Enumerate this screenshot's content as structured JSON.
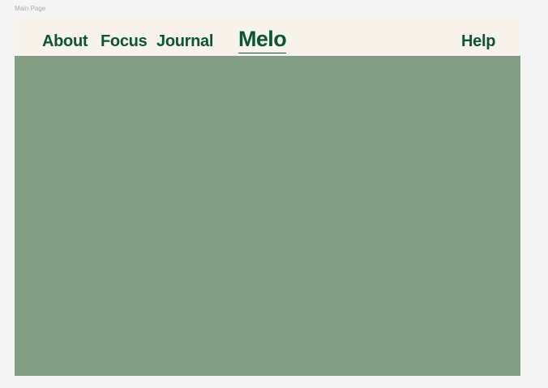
{
  "canvas": {
    "frame_label": "Main Page"
  },
  "nav": {
    "about": "About",
    "focus": "Focus",
    "journal": "Journal",
    "brand": "Melo",
    "help": "Help"
  },
  "colors": {
    "canvas_background": "#f5f5f5",
    "navbar_background": "#f7f3ea",
    "brand_green": "#0b5437",
    "content_background": "#819d84",
    "frame_label_gray": "#a8a8a8"
  }
}
